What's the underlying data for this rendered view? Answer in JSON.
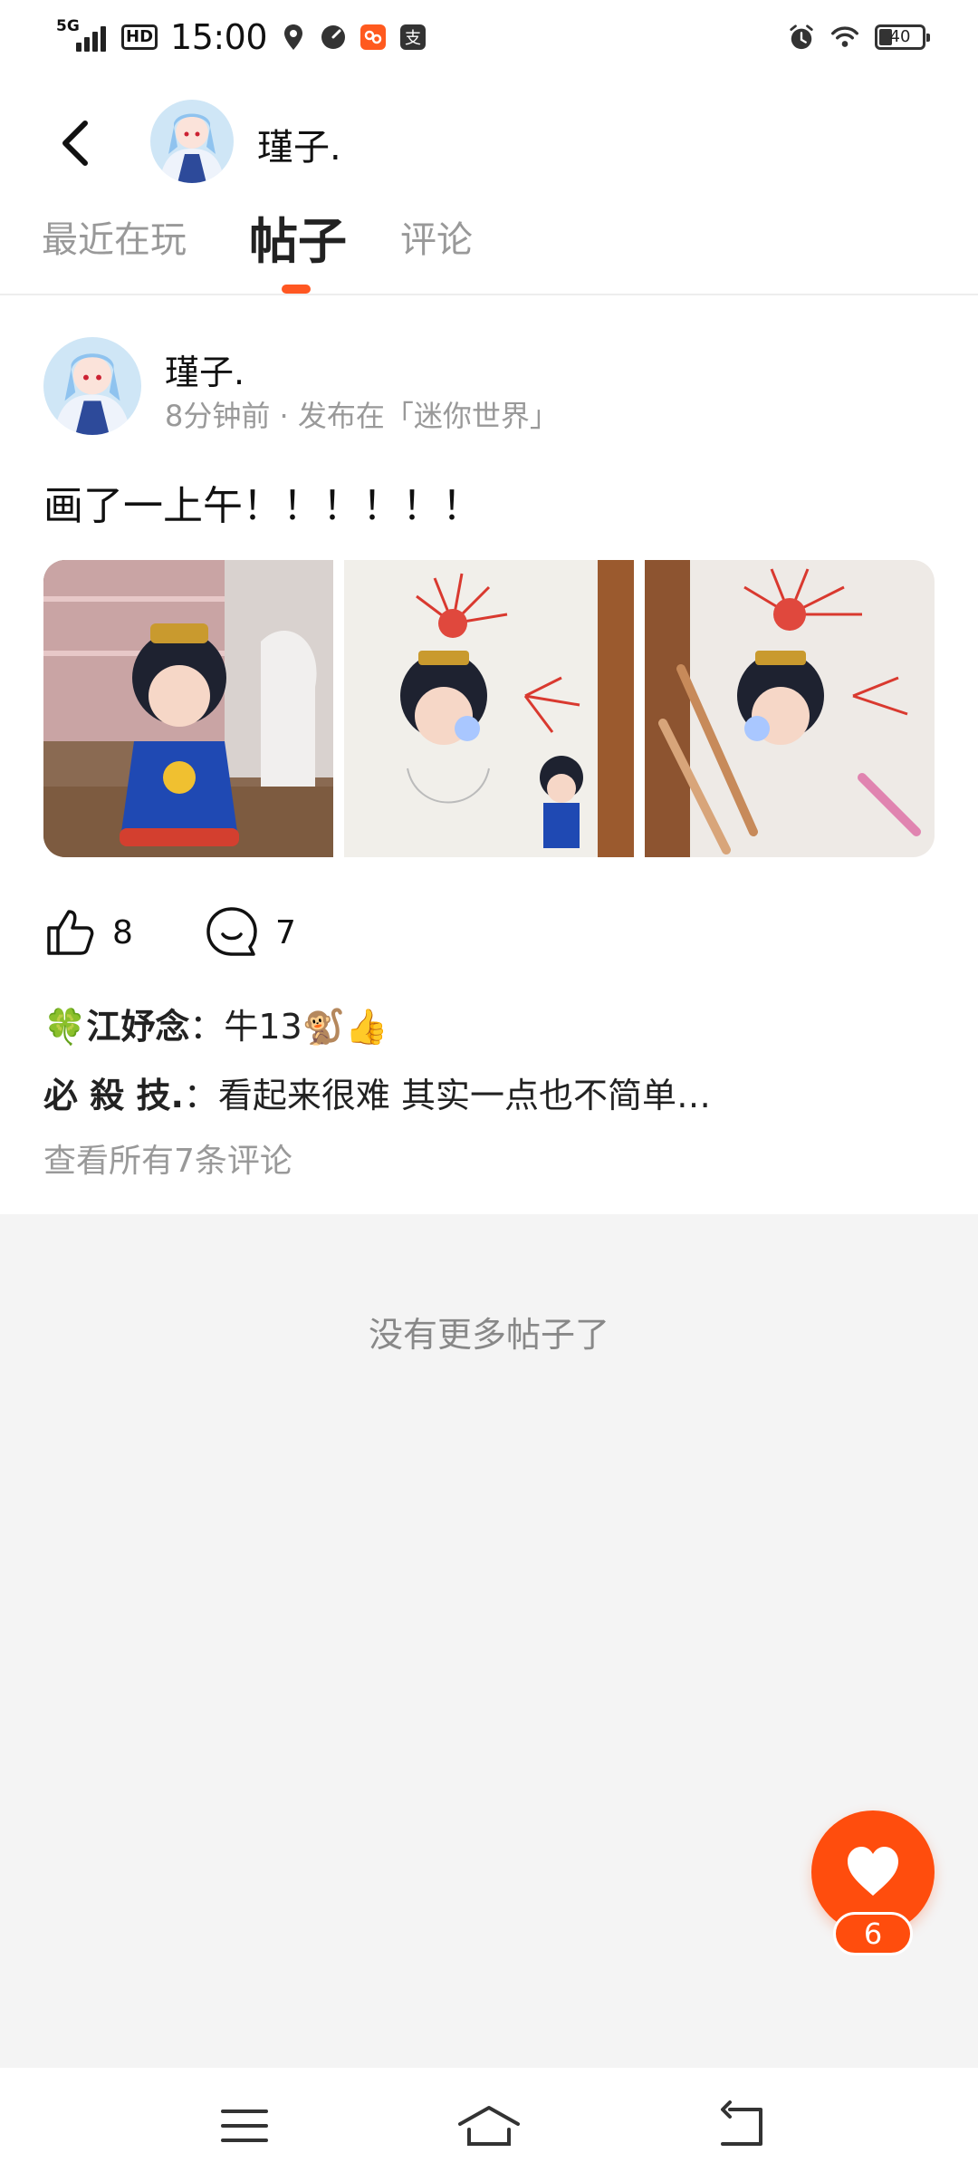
{
  "status_bar": {
    "network": "5G",
    "hd": "HD",
    "time": "15:00",
    "battery": "40",
    "app_icon_chars": [
      "支"
    ]
  },
  "header": {
    "username": "瑾子."
  },
  "tabs": [
    {
      "label": "最近在玩",
      "active": false
    },
    {
      "label": "帖子",
      "active": true
    },
    {
      "label": "评论",
      "active": false
    }
  ],
  "post": {
    "author": "瑾子.",
    "meta": "8分钟前 · 发布在「迷你世界」",
    "text": "画了一上午！！！！！！",
    "likes": "8",
    "comments": "7",
    "comment_previews": [
      {
        "user": "🍀江妤念",
        "sep": "：",
        "text": "牛13🐒👍"
      },
      {
        "user": "必 殺 技.",
        "sep": "：",
        "text": "看起来很难 其实一点也不简单…"
      }
    ],
    "view_all": "查看所有7条评论"
  },
  "footer_text": "没有更多帖子了",
  "fab": {
    "count": "6"
  },
  "colors": {
    "accent": "#ff5722",
    "fab": "#ff4d0d"
  }
}
